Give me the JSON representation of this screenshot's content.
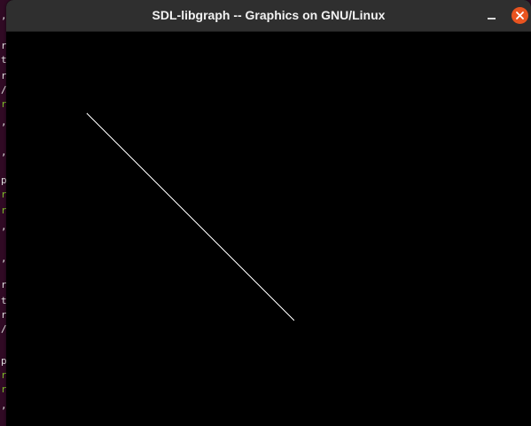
{
  "window": {
    "title": "SDL-libgraph -- Graphics on GNU/Linux",
    "accent_close": "#e95420",
    "titlebar_color": "#2f2f2f",
    "canvas_background": "#000000"
  },
  "terminal_behind": {
    "glyphs": [
      ",",
      "r",
      "t",
      "r",
      "/",
      "r",
      ",",
      ",",
      "p",
      "r",
      "r",
      ",",
      ",",
      "r",
      "t",
      "r",
      "/",
      "p",
      "r",
      "r",
      ","
    ]
  },
  "drawing": {
    "line_color": "#ffffff"
  },
  "icons": {
    "minimize": "minimize-icon",
    "close": "close-icon"
  }
}
